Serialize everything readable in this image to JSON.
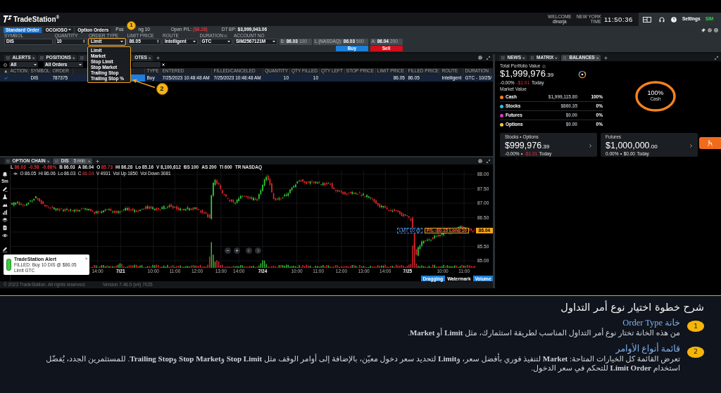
{
  "header": {
    "logo": "TradeStation$^{®}$",
    "welcome_label": "WELCOME",
    "user": "dlnorja",
    "clock_label_top": "NEW YORK",
    "clock_label_bottom": "TIME",
    "clock": "11:50:36",
    "settings": "Settings",
    "account_mode": "SIM"
  },
  "order_bar": {
    "tabs": [
      {
        "label": "Standard Order",
        "selected": true,
        "dropdown": false
      },
      {
        "label": "OCO/OSO",
        "selected": false,
        "dropdown": true
      },
      {
        "label": "Option Orders",
        "selected": false,
        "dropdown": false
      }
    ],
    "position_parts": [
      "Pos",
      "ng 10"
    ],
    "open_pl": {
      "label": "Open P/L:",
      "value": "($8.28)"
    },
    "day_trade_bp": {
      "label": "DT BP:",
      "value": "$3,999,043.06"
    },
    "fields": [
      {
        "label": "SYMBOL",
        "value": "DIS",
        "kind": "text",
        "highlighted": false,
        "info": false
      },
      {
        "label": "QUANTITY",
        "value": "10",
        "kind": "spinner",
        "highlighted": false,
        "info": false
      },
      {
        "label": "ORDER TYPE",
        "value": "Limit",
        "kind": "select",
        "highlighted": true,
        "info": false
      },
      {
        "label": "LIMIT PRICE",
        "value": "86.05",
        "kind": "spinner",
        "highlighted": false,
        "info": false
      },
      {
        "label": "ROUTE",
        "value": "Intelligent",
        "kind": "select",
        "highlighted": false,
        "info": false
      },
      {
        "label": "DURATION",
        "value": "GTC",
        "kind": "select",
        "highlighted": false,
        "info": true
      },
      {
        "label": "ACCOUNT NO",
        "value": "SIM2567121M",
        "kind": "select",
        "highlighted": false,
        "info": false
      }
    ],
    "quotes": [
      {
        "label": "B:",
        "price": "86.03",
        "size": "100"
      },
      {
        "label": "L (NASDAQ):",
        "price": "86.03",
        "size": "500"
      },
      {
        "label": "A:",
        "price": "86.04",
        "size": "200"
      }
    ],
    "buttons": [
      {
        "label": "Buy",
        "kind": "buy"
      },
      {
        "label": "Sell",
        "kind": "sell"
      }
    ]
  },
  "order_type_menu": {
    "options": [
      "Limit",
      "Market",
      "Stop Limit",
      "Stop Market",
      "Trailing Stop",
      "Trailing Stop %"
    ]
  },
  "callouts": [
    {
      "number": "1"
    },
    {
      "number": "2"
    }
  ],
  "orders_panel": {
    "tabs": [
      {
        "label": "ALERTS",
        "selected": false
      },
      {
        "label": "POSITIONS",
        "selected": false
      },
      {
        "label": "OTES",
        "selected": false
      }
    ],
    "filters": [
      "All",
      "All Orders"
    ],
    "columns": [
      "ACTION",
      "SYMBOL",
      "ORDER",
      "TYPE",
      "ENTERED",
      "FILLED/CANCELED",
      "QUANTITY",
      "QTY FILLED",
      "QTY LEFT",
      "STOP PRICE",
      "LIMIT PRICE",
      "FILLED PRICE",
      "ROUTE",
      "DURATION"
    ],
    "rows": [
      {
        "selected": true,
        "checked": true,
        "status_marker": true,
        "symbol": "DIS",
        "order": "787375",
        "type": "Buy",
        "entered": "7/25/2023 10:48:48 AM",
        "filled_canceled": "7/25/2023 10:48:48 AM",
        "quantity": "10",
        "qty_filled": "10",
        "limit_price": "86.05",
        "filled_price": "86.05",
        "route": "Intelligent",
        "duration": "GTC - 10/25/"
      }
    ]
  },
  "chart_panel": {
    "tabs": [
      {
        "label": "OPTION CHAIN",
        "selected": false
      },
      {
        "label": "DIS",
        "interval": "5 min",
        "selected": true
      }
    ],
    "quote_line": [
      {
        "label": "L",
        "value": "86.03",
        "negative": true
      },
      {
        "value": "-0.58",
        "negative": true
      },
      {
        "value": "-0.66%",
        "negative": true
      },
      {
        "label": "B",
        "value": "86.03",
        "negative": false
      },
      {
        "label": "A",
        "value": "86.04",
        "negative": false
      },
      {
        "label": "O",
        "value": "85.73",
        "negative": true
      },
      {
        "label": "Hi",
        "value": "86.28",
        "negative": false
      },
      {
        "label": "Lo",
        "value": "85.16",
        "negative": false
      },
      {
        "label": "V",
        "value": "8,100,612",
        "negative": false
      },
      {
        "label": "BS",
        "value": "100",
        "negative": false
      },
      {
        "label": "AS",
        "value": "200",
        "negative": false
      },
      {
        "label": "TI",
        "value": "600",
        "negative": false
      },
      {
        "label": "TR",
        "value": "NASDAQ",
        "negative": false
      }
    ],
    "interval_button": "5m",
    "bar_info": [
      {
        "label": "O",
        "value": "86.05",
        "negative": false
      },
      {
        "label": "Hi",
        "value": "86.06",
        "negative": false
      },
      {
        "label": "Lo",
        "value": "86.03",
        "negative": false
      },
      {
        "label": "C",
        "value": "86.04",
        "negative": true
      },
      {
        "label": "V",
        "value": "4931",
        "negative": false
      },
      {
        "label": "Vol Up",
        "value": "1850",
        "negative": false
      },
      {
        "label": "Vol Down",
        "value": "3081",
        "negative": false
      }
    ],
    "price_axis": {
      "upper": [
        "88.00",
        "87.50",
        "87.00",
        "86.50"
      ],
      "lower": [
        "85.50",
        "85.00"
      ]
    },
    "price_tag": "86.04",
    "time_axis": [
      {
        "label": "14:00",
        "kind": "time"
      },
      {
        "label": "7/21",
        "kind": "date"
      },
      {
        "label": "10:00",
        "kind": "time"
      },
      {
        "label": "11:00",
        "kind": "time"
      },
      {
        "label": "12:00",
        "kind": "time"
      },
      {
        "label": "13:00",
        "kind": "time"
      },
      {
        "label": "14:00",
        "kind": "time"
      },
      {
        "label": "7/24",
        "kind": "date"
      },
      {
        "label": "10:00",
        "kind": "time"
      },
      {
        "label": "11:00",
        "kind": "time"
      },
      {
        "label": "12:00",
        "kind": "time"
      },
      {
        "label": "13:00",
        "kind": "time"
      },
      {
        "label": "14:00",
        "kind": "time"
      },
      {
        "label": "7/25",
        "kind": "date"
      },
      {
        "label": "10:00",
        "kind": "time"
      },
      {
        "label": "11:00",
        "kind": "time"
      }
    ],
    "order_line": {
      "label": "LMT 10 @",
      "position": "P/L -$0.15 Long 10"
    },
    "toggles": [
      {
        "label": "Dragging",
        "on": true
      },
      {
        "label": "Watermark",
        "on": false
      },
      {
        "label": "Volume",
        "on": true
      }
    ],
    "alert": {
      "title": "TradeStation Alert",
      "message": "FILLED: Buy 10 DIS @ $86.05 Limit GTC"
    }
  },
  "footer": {
    "copyright": "© 2023 TradeStation. All rights reserved.",
    "version": "Version 7.46.0 (v4) 7025"
  },
  "balances_panel": {
    "tabs": [
      {
        "label": "NEWS",
        "selected": false
      },
      {
        "label": "MATRIX",
        "selected": false
      },
      {
        "label": "BALANCES",
        "selected": true
      }
    ],
    "total": {
      "label": "Total Portfolio Value",
      "value": "$1,999,976",
      "cents": ".39",
      "change_pct": "-0.00%",
      "change": "-$1.01",
      "period": "Today",
      "negative": true
    },
    "market_value_label": "Market Value",
    "assets": [
      {
        "name": "Cash",
        "value": "$1,999,115.80",
        "share": "100%",
        "color": "#f5821f"
      },
      {
        "name": "Stocks",
        "value": "$860.35",
        "share": "0%",
        "color": "#29c5e6"
      },
      {
        "name": "Futures",
        "value": "$0.00",
        "share": "0%",
        "color": "#d63ad6"
      },
      {
        "name": "Options",
        "value": "$0.00",
        "share": "0%",
        "color": "#f0cc3a"
      }
    ],
    "allocation_ring": {
      "percent": "100%",
      "label": "Cash"
    },
    "cards": [
      {
        "title": "Stocks • Options",
        "value": "$999,976",
        "cents": ".39",
        "change_pct": "-0.00%",
        "separator": "•",
        "change": "-$1.01",
        "period": "Today",
        "negative": true
      },
      {
        "title": "Futures",
        "value": "$1,000,000",
        "cents": ".00",
        "change_pct": "0.00%",
        "separator": "•",
        "change": "$0.00",
        "period": "Today",
        "negative": false
      }
    ]
  },
  "explanation": {
    "title": "شرح خطوة اختيار نوع أمر التداول",
    "items": [
      {
        "number": "1",
        "heading": "خانة Order Type",
        "text": "من هذه الخانة تختار نوع أمر التداول المناسب لطريقة استثمارك، مثل **Limit** أو **Market**."
      },
      {
        "number": "2",
        "heading": "قائمة أنواع الأوامر",
        "text": "تعرض القائمة كل الخيارات المتاحة: **Market** لتنفيذ فوري بأفضل سعر، و**Limit** لتحديد سعر دخول معيّن، بالإضافة إلى أوامر الوقف مثل **Stop Limit** و**Stop Market** و**Trailing Stop**. للمستثمرين الجدد، يُفضّل استخدام **Limit Order** للتحكم في سعر الدخول."
      }
    ]
  }
}
